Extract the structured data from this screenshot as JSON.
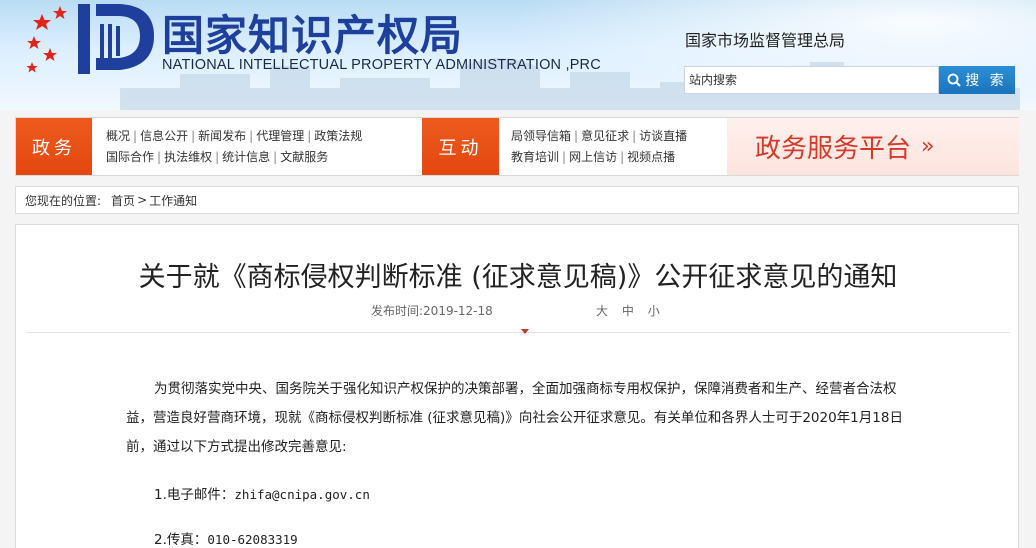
{
  "header": {
    "logo_title": "国家知识产权局",
    "logo_subtitle": "NATIONAL INTELLECTUAL PROPERTY ADMINISTRATION ,PRC",
    "org_name": "国家市场监督管理总局",
    "search_placeholder": "站内搜索",
    "search_button": "搜 索"
  },
  "nav": {
    "gov_label": "政务",
    "gov_links_row1": [
      "概况",
      "信息公开",
      "新闻发布",
      "代理管理",
      "政策法规"
    ],
    "gov_links_row2": [
      "国际合作",
      "执法维权",
      "统计信息",
      "文献服务"
    ],
    "interact_label": "互动",
    "interact_links_row1": [
      "局领导信箱",
      "意见征求",
      "访谈直播"
    ],
    "interact_links_row2": [
      "教育培训",
      "网上信访",
      "视频点播"
    ],
    "platform_label": "政务服务平台",
    "platform_chevron": "»"
  },
  "breadcrumb": {
    "label": "您现在的位置:",
    "home": "首页",
    "arrow": ">",
    "current": "工作通知"
  },
  "article": {
    "title": "关于就《商标侵权判断标准 (征求意见稿)》公开征求意见的通知",
    "date_label": "发布时间:",
    "date": "2019-12-18",
    "font_sizes": [
      "大",
      "中",
      "小"
    ],
    "paragraph": "为贯彻落实党中央、国务院关于强化知识产权保护的决策部署，全面加强商标专用权保护，保障消费者和生产、经营者合法权益，营造良好营商环境，现就《商标侵权判断标准 (征求意见稿)》向社会公开征求意见。有关单位和各界人士可于2020年1月18日前，通过以下方式提出修改完善意见:",
    "item1_label": "1.电子邮件：",
    "item1_value": "zhifa@cnipa.gov.cn",
    "item2_label": "2.传真：",
    "item2_value": "010-62083319"
  },
  "colors": {
    "nav_orange": "#e2470f",
    "platform_red": "#d63a2b",
    "logo_blue": "#1f3f9c",
    "search_blue": "#1a72bd"
  }
}
